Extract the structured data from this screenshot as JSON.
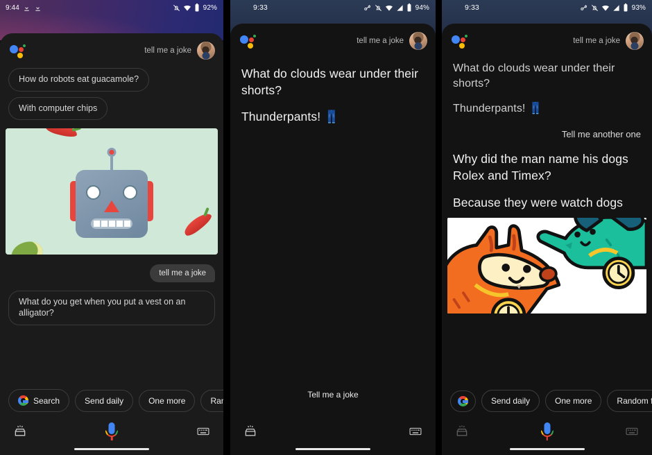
{
  "panels": [
    {
      "id": "panel-robot-joke",
      "statusbar": {
        "time": "9:44",
        "left_icons": [
          "download-icon",
          "download-icon"
        ],
        "right_icons": [
          "notifications-off-icon",
          "wifi-icon",
          "battery-icon"
        ],
        "battery": "92%"
      },
      "header": {
        "logo": "google-assistant-logo",
        "query": "tell me a joke",
        "avatar": "user-avatar"
      },
      "suggestions": [
        "How do robots eat guacamole?",
        "With computer chips"
      ],
      "image_card": "robot-guacamole-illustration",
      "user_message": "tell me a joke",
      "assistant_bubble": "What do you get when you put a vest on an alligator?",
      "chips": [
        {
          "icon": "google-g-icon",
          "label": "Search"
        },
        {
          "icon": "",
          "label": "Send daily"
        },
        {
          "icon": "",
          "label": "One more"
        },
        {
          "icon": "",
          "label": "Random fun"
        }
      ],
      "bottom": {
        "left_icon": "explore-inbox-icon",
        "center_icon": "microphone-icon",
        "right_icon": "keyboard-icon"
      }
    },
    {
      "id": "panel-thunderpants",
      "statusbar": {
        "time": "9:33",
        "left_icons": [],
        "right_icons": [
          "screen-cast-icon",
          "notifications-off-icon",
          "wifi-icon",
          "signal-icon",
          "battery-icon"
        ],
        "battery": "94%"
      },
      "header": {
        "logo": "google-assistant-logo",
        "query": "tell me a joke",
        "avatar": "user-avatar"
      },
      "answer_lines": [
        "What do clouds wear under their shorts?",
        "Thunderpants! 👖"
      ],
      "listening_label": "Tell me a joke",
      "bottom": {
        "left_icon": "explore-inbox-icon",
        "right_icon": "keyboard-icon"
      }
    },
    {
      "id": "panel-watch-dogs",
      "statusbar": {
        "time": "9:33",
        "left_icons": [],
        "right_icons": [
          "screen-cast-icon",
          "notifications-off-icon",
          "wifi-icon",
          "signal-icon",
          "battery-icon"
        ],
        "battery": "93%"
      },
      "header": {
        "logo": "google-assistant-logo",
        "query": "tell me a joke",
        "avatar": "user-avatar"
      },
      "prev_answer_lines": [
        "What do clouds wear under their shorts?",
        "Thunderpants! 👖"
      ],
      "user_message": "Tell me another one",
      "answer_lines": [
        "Why did the man name his dogs Rolex and Timex?",
        "Because they were watch dogs"
      ],
      "image_card": "two-dogs-with-watches-illustration",
      "chips": [
        {
          "icon": "google-g-icon",
          "label": ""
        },
        {
          "icon": "",
          "label": "Send daily"
        },
        {
          "icon": "",
          "label": "One more"
        },
        {
          "icon": "",
          "label": "Random fun"
        }
      ],
      "bottom": {
        "left_icon": "explore-inbox-icon",
        "center_icon": "microphone-icon",
        "right_icon": "keyboard-icon"
      }
    }
  ],
  "colors": {
    "assistant_blue": "#4285f4",
    "assistant_red": "#ea4335",
    "assistant_yellow": "#fbbc05",
    "assistant_green": "#34a853",
    "sheet_bg": "#1b1b1b",
    "dark_bg": "#131313"
  }
}
